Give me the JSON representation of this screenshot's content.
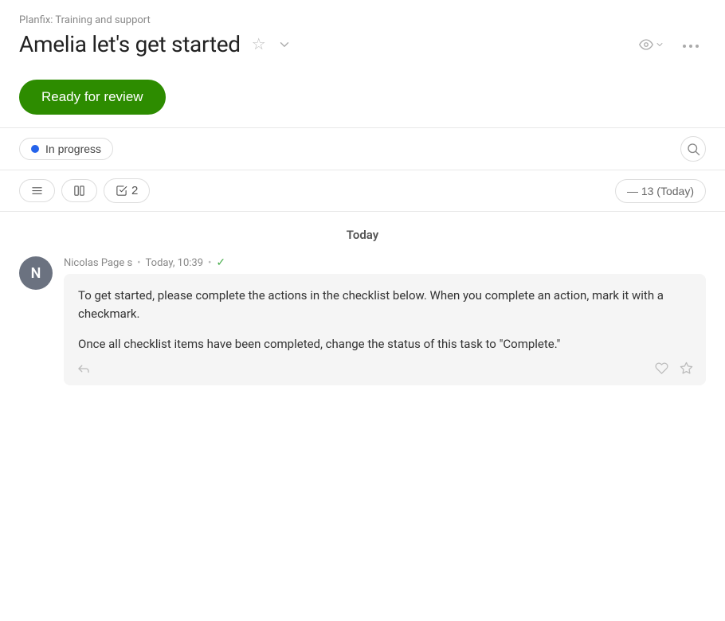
{
  "breadcrumb": "Planfix: Training and support",
  "title": "Amelia let's get started",
  "review_button": "Ready for review",
  "status": {
    "label": "In progress",
    "dot_color": "#2563eb"
  },
  "toolbar": {
    "date_label": "— 13 (Today)",
    "checklist_count": "2"
  },
  "feed": {
    "day_label": "Today",
    "messages": [
      {
        "author_initial": "N",
        "author": "Nicolas Page s",
        "time": "Today, 10:39",
        "avatar_bg": "#6b7280",
        "paragraphs": [
          "To get started, please complete the actions in the checklist below. When you complete an action, mark it with a checkmark.",
          "Once all checklist items have been completed, change the status of this task to \"Complete.\""
        ]
      }
    ]
  },
  "icons": {
    "star": "☆",
    "chevron_down": "▾",
    "eye": "👁",
    "more": "•••",
    "search": "○",
    "list": "≡",
    "columns": "⊞",
    "checklist": "☑",
    "reply": "↩",
    "like": "♡",
    "fav": "☆"
  }
}
